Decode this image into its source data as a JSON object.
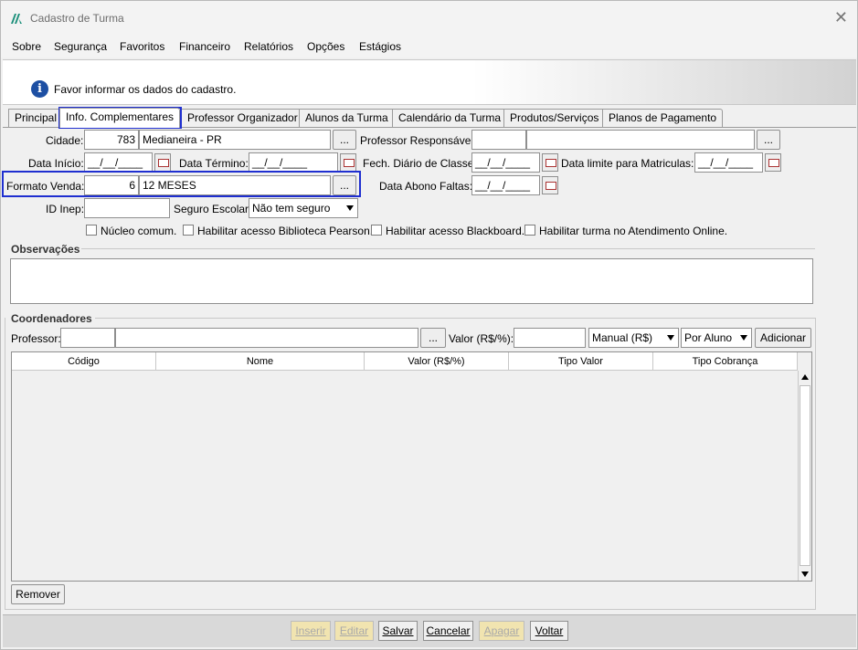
{
  "window": {
    "title": "Cadastro de Turma",
    "close": "✕"
  },
  "menu": [
    "Sobre",
    "Segurança",
    "Favoritos",
    "Financeiro",
    "Relatórios",
    "Opções",
    "Estágios"
  ],
  "info": {
    "message": "Favor informar os dados do cadastro.",
    "icon": "i"
  },
  "tabs": [
    "Principal",
    "Info. Complementares",
    "Professor Organizador",
    "Alunos da Turma",
    "Calendário da Turma",
    "Produtos/Serviços",
    "Planos de Pagamento"
  ],
  "form": {
    "cidade_label": "Cidade:",
    "cidade_code": "783",
    "cidade_name": "Medianeira - PR",
    "professor_resp_label": "Professor Responsável:",
    "professor_resp_code": "",
    "professor_resp_name": "",
    "data_inicio_label": "Data Início:",
    "data_inicio": "__/__/____",
    "data_termino_label": "Data Término:",
    "data_termino": "__/__/____",
    "fech_diario_label": "Fech. Diário de Classe:",
    "fech_diario": "__/__/____",
    "data_limite_label": "Data limite para Matriculas:",
    "data_limite": "__/__/____",
    "formato_venda_label": "Formato Venda:",
    "formato_venda_code": "6",
    "formato_venda_name": "12 MESES",
    "data_abono_label": "Data Abono Faltas:",
    "data_abono": "__/__/____",
    "id_inep_label": "ID Inep:",
    "id_inep": "",
    "seguro_label": "Seguro Escolar:",
    "seguro_value": "Não tem seguro",
    "ellipsis": "..."
  },
  "checkboxes": [
    "Núcleo comum.",
    "Habilitar acesso Biblioteca Pearson.",
    "Habilitar acesso Blackboard.",
    "Habilitar turma no Atendimento Online."
  ],
  "observacoes_label": "Observações",
  "coordenadores": {
    "group_label": "Coordenadores",
    "professor_label": "Professor:",
    "valor_label": "Valor (R$/%):",
    "tipo_valor": "Manual (R$)",
    "tipo_cobranca": "Por Aluno",
    "adicionar": "Adicionar",
    "columns": [
      "Código",
      "Nome",
      "Valor (R$/%)",
      "Tipo Valor",
      "Tipo Cobrança"
    ],
    "remover": "Remover"
  },
  "actions": [
    "Inserir",
    "Editar",
    "Salvar",
    "Cancelar",
    "Apagar",
    "Voltar"
  ],
  "colors": {
    "highlight": "#1f2fd0",
    "disabled_bg": "#f1e4b0",
    "info_icon": "#1d4fa3"
  }
}
